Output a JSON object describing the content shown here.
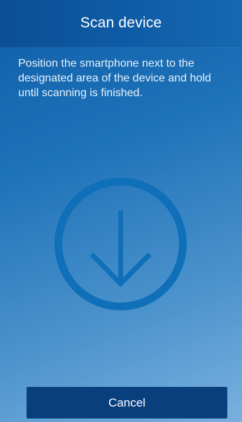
{
  "header": {
    "title": "Scan device"
  },
  "instructions": {
    "text": "Position the smartphone next to the designated area of the device and hold until scanning is finished."
  },
  "scan_icon": {
    "name": "download-arrow-circle-icon",
    "color": "#0f6fb8"
  },
  "footer": {
    "cancel_label": "Cancel"
  },
  "colors": {
    "header_bg": "#0e5ba5",
    "button_bg": "#0a3f7e",
    "text": "#ffffff"
  }
}
